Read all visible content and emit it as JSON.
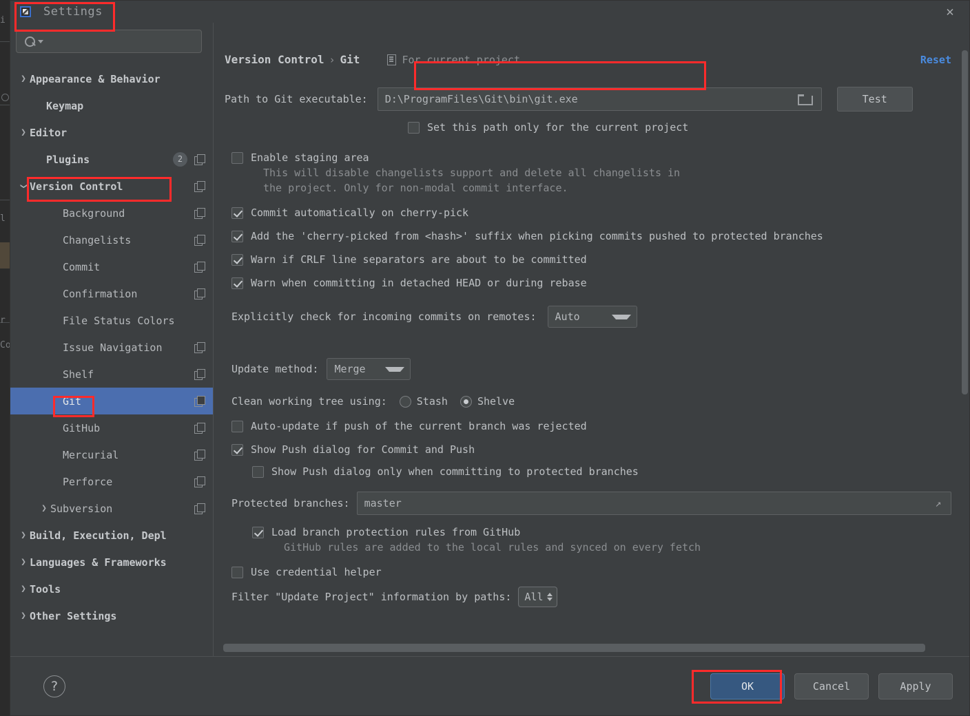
{
  "window": {
    "title": "Settings",
    "app_icon": "intellij-idea-icon",
    "close_icon": "close-icon"
  },
  "search": {
    "placeholder": "",
    "value": "",
    "icon": "search-icon"
  },
  "sidebar": {
    "items": [
      {
        "label": "Appearance & Behavior",
        "arrow": "right",
        "indent": 0,
        "bold": true,
        "badge": null,
        "copy": false,
        "selected": false
      },
      {
        "label": "Keymap",
        "arrow": "none",
        "indent": 1,
        "bold": true,
        "badge": null,
        "copy": false,
        "selected": false
      },
      {
        "label": "Editor",
        "arrow": "right",
        "indent": 0,
        "bold": true,
        "badge": null,
        "copy": false,
        "selected": false
      },
      {
        "label": "Plugins",
        "arrow": "none",
        "indent": 1,
        "bold": true,
        "badge": "2",
        "copy": true,
        "selected": false
      },
      {
        "label": "Version Control",
        "arrow": "down",
        "indent": 0,
        "bold": true,
        "badge": null,
        "copy": true,
        "selected": false
      },
      {
        "label": "Background",
        "arrow": "none",
        "indent": 2,
        "bold": false,
        "badge": null,
        "copy": true,
        "selected": false
      },
      {
        "label": "Changelists",
        "arrow": "none",
        "indent": 2,
        "bold": false,
        "badge": null,
        "copy": true,
        "selected": false
      },
      {
        "label": "Commit",
        "arrow": "none",
        "indent": 2,
        "bold": false,
        "badge": null,
        "copy": true,
        "selected": false
      },
      {
        "label": "Confirmation",
        "arrow": "none",
        "indent": 2,
        "bold": false,
        "badge": null,
        "copy": true,
        "selected": false
      },
      {
        "label": "File Status Colors",
        "arrow": "none",
        "indent": 2,
        "bold": false,
        "badge": null,
        "copy": false,
        "selected": false
      },
      {
        "label": "Issue Navigation",
        "arrow": "none",
        "indent": 2,
        "bold": false,
        "badge": null,
        "copy": true,
        "selected": false
      },
      {
        "label": "Shelf",
        "arrow": "none",
        "indent": 2,
        "bold": false,
        "badge": null,
        "copy": true,
        "selected": false
      },
      {
        "label": "Git",
        "arrow": "none",
        "indent": 2,
        "bold": false,
        "badge": null,
        "copy": true,
        "selected": true
      },
      {
        "label": "GitHub",
        "arrow": "none",
        "indent": 2,
        "bold": false,
        "badge": null,
        "copy": true,
        "selected": false
      },
      {
        "label": "Mercurial",
        "arrow": "none",
        "indent": 2,
        "bold": false,
        "badge": null,
        "copy": true,
        "selected": false
      },
      {
        "label": "Perforce",
        "arrow": "none",
        "indent": 2,
        "bold": false,
        "badge": null,
        "copy": true,
        "selected": false
      },
      {
        "label": "Subversion",
        "arrow": "right",
        "indent": 3,
        "bold": false,
        "badge": null,
        "copy": true,
        "selected": false
      },
      {
        "label": "Build, Execution, Depl",
        "arrow": "right",
        "indent": 0,
        "bold": true,
        "badge": null,
        "copy": false,
        "selected": false
      },
      {
        "label": "Languages & Frameworks",
        "arrow": "right",
        "indent": 0,
        "bold": true,
        "badge": null,
        "copy": false,
        "selected": false
      },
      {
        "label": "Tools",
        "arrow": "right",
        "indent": 0,
        "bold": true,
        "badge": null,
        "copy": false,
        "selected": false
      },
      {
        "label": "Other Settings",
        "arrow": "right",
        "indent": 0,
        "bold": true,
        "badge": null,
        "copy": false,
        "selected": false
      }
    ]
  },
  "main": {
    "breadcrumb": {
      "parent": "Version Control",
      "separator": "›",
      "current": "Git"
    },
    "project_scope": {
      "icon": "project-scope-icon",
      "text": "For current project"
    },
    "reset_link": "Reset",
    "path": {
      "label": "Path to Git executable:",
      "value": "D:\\ProgramFiles\\Git\\bin\\git.exe",
      "browse_icon": "folder-icon",
      "test_button": "Test"
    },
    "set_path_only": {
      "label": "Set this path only for the current project",
      "checked": false
    },
    "enable_staging": {
      "label": "Enable staging area",
      "checked": false
    },
    "staging_help": "This will disable changelists support and delete all changelists in\nthe project. Only for non-modal commit interface.",
    "checkboxes": [
      {
        "label": "Commit automatically on cherry-pick",
        "checked": true
      },
      {
        "label": "Add the 'cherry-picked from <hash>' suffix when picking commits pushed to protected branches",
        "checked": true
      },
      {
        "label": "Warn if CRLF line separators are about to be committed",
        "checked": true
      },
      {
        "label": "Warn when committing in detached HEAD or during rebase",
        "checked": true
      }
    ],
    "incoming_commits": {
      "label": "Explicitly check for incoming commits on remotes:",
      "value": "Auto"
    },
    "update_method": {
      "label": "Update method:",
      "value": "Merge"
    },
    "clean_working_tree": {
      "label": "Clean working tree using:",
      "options": [
        "Stash",
        "Shelve"
      ],
      "selected": "Shelve"
    },
    "auto_update": {
      "label": "Auto-update if push of the current branch was rejected",
      "checked": false
    },
    "show_push_dialog": {
      "label": "Show Push dialog for Commit and Push",
      "checked": true
    },
    "show_push_protected": {
      "label": "Show Push dialog only when committing to protected branches",
      "checked": false
    },
    "protected_branches": {
      "label": "Protected branches:",
      "value": "master",
      "expand_icon": "expand-icon"
    },
    "load_branch_rules": {
      "label": "Load branch protection rules from GitHub",
      "checked": true
    },
    "github_rules_help": "GitHub rules are added to the local rules and synced on every fetch",
    "use_credential_helper": {
      "label": "Use credential helper",
      "checked": false
    },
    "filter_paths": {
      "label": "Filter \"Update Project\" information by paths:",
      "value": "All"
    }
  },
  "footer": {
    "help_icon": "?",
    "ok": "OK",
    "cancel": "Cancel",
    "apply": "Apply"
  },
  "colors": {
    "accent_blue": "#4b6eaf",
    "link_blue": "#4a8bdf",
    "ok_button": "#365880",
    "annotation_red": "#ff2b2b",
    "panel_bg": "#3c3f41",
    "field_bg": "#45494a"
  }
}
